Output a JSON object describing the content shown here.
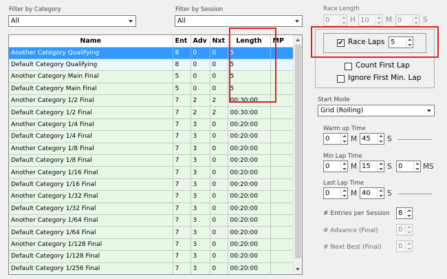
{
  "filters": {
    "category_label": "Filter by Category",
    "category_value": "All",
    "session_label": "Filter by Session",
    "session_value": "All"
  },
  "grid": {
    "columns": [
      "Name",
      "Ent",
      "Adv",
      "Nxt",
      "Length",
      "MP"
    ],
    "rows": [
      [
        "Another Category Qualifying",
        "8",
        "0",
        "0",
        "5"
      ],
      [
        "Default Category Qualifying",
        "8",
        "0",
        "0",
        "5"
      ],
      [
        "Another Category Main Final",
        "5",
        "0",
        "0",
        "5"
      ],
      [
        "Default Category Main Final",
        "5",
        "0",
        "0",
        "5"
      ],
      [
        "Another Category 1/2 Final",
        "7",
        "2",
        "2",
        "00:30:00"
      ],
      [
        "Default Category 1/2 Final",
        "7",
        "2",
        "2",
        "00:30:00"
      ],
      [
        "Another Category 1/4 Final",
        "7",
        "3",
        "0",
        "00:20:00"
      ],
      [
        "Default Category 1/4 Final",
        "7",
        "3",
        "0",
        "00:20:00"
      ],
      [
        "Another Category 1/8 Final",
        "7",
        "3",
        "0",
        "00:20:00"
      ],
      [
        "Default Category 1/8 Final",
        "7",
        "3",
        "0",
        "00:20:00"
      ],
      [
        "Another Category 1/16 Final",
        "7",
        "3",
        "0",
        "00:20:00"
      ],
      [
        "Default Category 1/16 Final",
        "7",
        "3",
        "0",
        "00:20:00"
      ],
      [
        "Another Category 1/32 Final",
        "7",
        "3",
        "0",
        "00:20:00"
      ],
      [
        "Default Category 1/32 Final",
        "7",
        "3",
        "0",
        "00:20:00"
      ],
      [
        "Another Category 1/64 Final",
        "7",
        "3",
        "0",
        "00:20:00"
      ],
      [
        "Default Category 1/64 Final",
        "7",
        "3",
        "0",
        "00:20:00"
      ],
      [
        "Another Category 1/128 Final",
        "7",
        "3",
        "0",
        "00:20:00"
      ],
      [
        "Default Category 1/128 Final",
        "7",
        "3",
        "0",
        "00:20:00"
      ],
      [
        "Default Category 1/256 Final",
        "7",
        "3",
        "0",
        "00:20:00"
      ]
    ],
    "selected_row": 0
  },
  "race_length": {
    "label": "Race Length",
    "hours": "0",
    "hours_unit": "H",
    "minutes": "10",
    "minutes_unit": "M",
    "seconds": "0",
    "seconds_unit": "S",
    "race_laps_label": "Race Laps",
    "race_laps_checked": true,
    "race_laps_value": "5",
    "count_first_lap_label": "Count First Lap",
    "ignore_first_min_lap_label": "Ignore First Min. Lap"
  },
  "start_mode": {
    "label": "Start Mode",
    "value": "Grid (Rolling)"
  },
  "warm_up": {
    "label": "Warm up Time",
    "minutes": "0",
    "minutes_unit": "M",
    "seconds": "45",
    "seconds_unit": "S"
  },
  "min_lap": {
    "label": "Min Lap Time",
    "minutes": "0",
    "minutes_unit": "M",
    "seconds": "15",
    "seconds_unit": "S",
    "ms": "0",
    "ms_unit": "MS"
  },
  "last_lap": {
    "label": "Last Lap Time",
    "minutes": "0",
    "minutes_unit": "M",
    "seconds": "40",
    "seconds_unit": "S"
  },
  "session_counts": {
    "entries_label": "# Entries per Session",
    "entries_value": "8",
    "advance_label": "# Advance (Final)",
    "advance_value": "0",
    "next_best_label": "# Next Best (Final)",
    "next_best_value": "0"
  },
  "colors": {
    "selected_row": "#3399ff",
    "row_bg": "#e7f8e5",
    "highlight": "#e02020"
  }
}
